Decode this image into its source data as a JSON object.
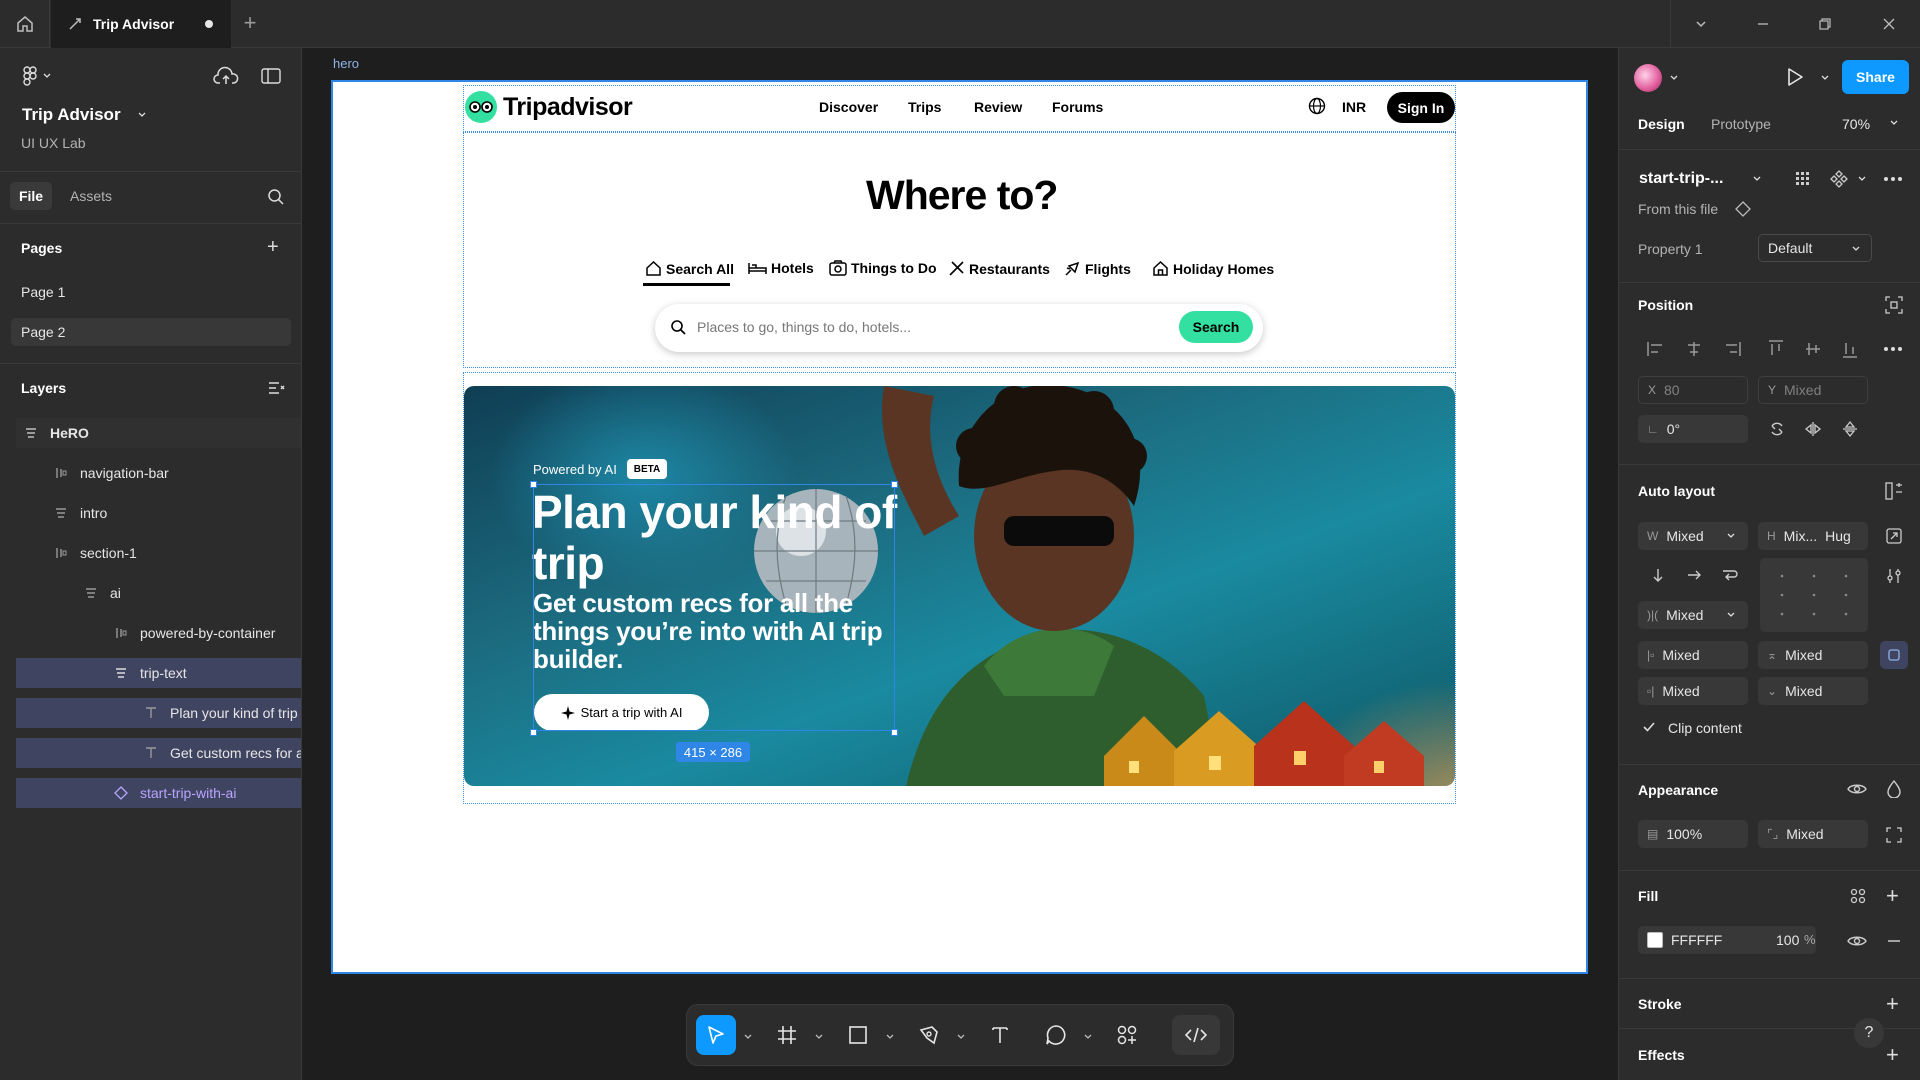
{
  "tab": {
    "title": "Trip Advisor"
  },
  "project": {
    "title": "Trip Advisor",
    "team": "UI UX Lab"
  },
  "left_tabs": {
    "file": "File",
    "assets": "Assets"
  },
  "pages": {
    "header": "Pages",
    "items": [
      {
        "label": "Page 1"
      },
      {
        "label": "Page 2"
      }
    ]
  },
  "layers": {
    "header": "Layers",
    "items": [
      {
        "label": "HeRO"
      },
      {
        "label": "navigation-bar"
      },
      {
        "label": "intro"
      },
      {
        "label": "section-1"
      },
      {
        "label": "ai"
      },
      {
        "label": "powered-by-container"
      },
      {
        "label": "trip-text"
      },
      {
        "label": "Plan your kind of trip"
      },
      {
        "label": "Get custom recs for all the things you're into with AI trip builder."
      },
      {
        "label": "start-trip-with-ai"
      }
    ]
  },
  "canvas": {
    "frame_label": "hero",
    "site": {
      "logo": "Tripadvisor",
      "nav": [
        "Discover",
        "Trips",
        "Review",
        "Forums"
      ],
      "currency": "INR",
      "signin": "Sign In",
      "heading": "Where to?",
      "categories": [
        "Search All",
        "Hotels",
        "Things to Do",
        "Restaurants",
        "Flights",
        "Holiday Homes"
      ],
      "search_placeholder": "Places to go, things to do, hotels...",
      "search_button": "Search",
      "powered_by": "Powered by AI",
      "beta": "BETA",
      "hero_title": "Plan your kind of trip",
      "hero_subtitle": "Get custom recs for all the things you’re into with AI trip builder.",
      "hero_button": "Start a trip with AI"
    },
    "selection_size": "415 × 286"
  },
  "right_panel": {
    "share": "Share",
    "tabs": {
      "design": "Design",
      "prototype": "Prototype"
    },
    "zoom": "70%",
    "component_name": "start-trip-...",
    "from_file": "From this file",
    "property_label": "Property 1",
    "property_value": "Default",
    "position_header": "Position",
    "x_label": "X",
    "x_value": "80",
    "y_label": "Y",
    "y_value": "Mixed",
    "rotation": "0°",
    "auto_layout_header": "Auto layout",
    "w_label": "W",
    "w_value": "Mixed",
    "h_label": "H",
    "h_value": "Mix...",
    "h_mode": "Hug",
    "gap_value": "Mixed",
    "pad_left": "Mixed",
    "pad_top": "Mixed",
    "pad_right": "Mixed",
    "pad_bottom": "Mixed",
    "clip_content": "Clip content",
    "appearance_header": "Appearance",
    "opacity": "100%",
    "radius": "Mixed",
    "fill_header": "Fill",
    "fill_hex": "FFFFFF",
    "fill_opacity": "100",
    "fill_unit": "%",
    "stroke_header": "Stroke",
    "effects_header": "Effects",
    "help": "?"
  },
  "colors": {
    "accent": "#0d99ff",
    "brand_green": "#34e0a1",
    "selection": "#2f86e6",
    "component": "#b9a4ff"
  }
}
